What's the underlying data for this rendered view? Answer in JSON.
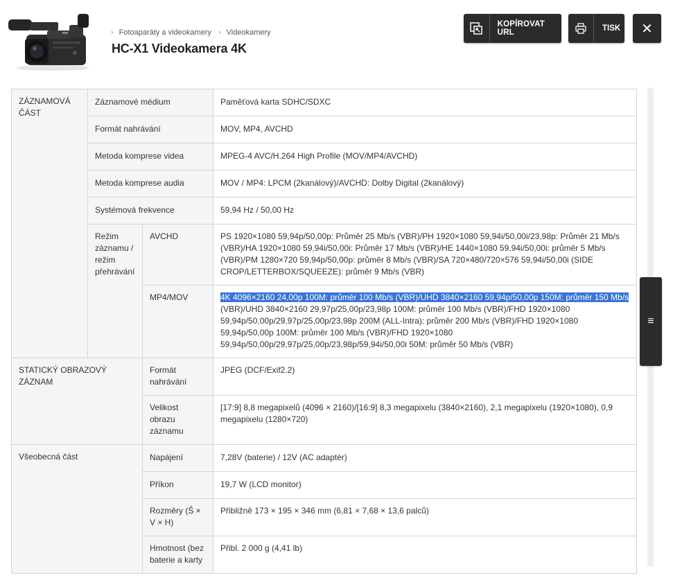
{
  "header": {
    "breadcrumb": [
      "Fotoaparáty a videokamery",
      "Videokamery"
    ],
    "title": "HC-X1 Videokamera 4K"
  },
  "actions": {
    "copy_url": "KOPÍROVAT URL",
    "print": "TISK",
    "close": "✕"
  },
  "scroll": {
    "thumb_glyph": "≡"
  },
  "specs": {
    "recording": {
      "group": "ZÁZNAMOVÁ ČÁST",
      "medium": {
        "label": "Záznamové médium",
        "value": "Paměťová karta SDHC/SDXC"
      },
      "format": {
        "label": "Formát nahrávání",
        "value": "MOV, MP4, AVCHD"
      },
      "video_compression": {
        "label": "Metoda komprese videa",
        "value": "MPEG-4 AVC/H.264 High Profile (MOV/MP4/AVCHD)"
      },
      "audio_compression": {
        "label": "Metoda komprese audia",
        "value": "MOV / MP4: LPCM (2kanálový)/AVCHD: Dolby Digital (2kanálový)"
      },
      "system_frequency": {
        "label": "Systémová frekvence",
        "value": "59,94 Hz / 50,00 Hz"
      },
      "mode": {
        "label": "Režim záznamu / režim přehrávání",
        "avchd": {
          "label": "AVCHD",
          "value": "PS 1920×1080 59,94p/50,00p: Průměr 25 Mb/s (VBR)/PH 1920×1080 59,94i/50,00i/23,98p: Průměr 21 Mb/s (VBR)/HA 1920×1080 59,94i/50,00i: Průměr 17 Mb/s (VBR)/HE 1440×1080 59,94i/50,00i: průměr 5 Mb/s (VBR)/PM 1280×720 59,94p/50,00p: průměr 8 Mb/s (VBR)/SA 720×480/720×576 59,94i/50,00i (SIDE CROP/LETTERBOX/SQUEEZE): průměr 9 Mb/s (VBR)"
        },
        "mp4mov": {
          "label": "MP4/MOV",
          "value_selected": "4K 4096×2160 24,00p 100M: průměr 100 Mb/s (VBR)/UHD 3840×2160 59,94p/50,00p 150M: průměr 150 Mb/s",
          "value_rest": " (VBR)/UHD 3840×2160 29,97p/25,00p/23,98p 100M: průměr 100 Mb/s (VBR)/FHD 1920×1080 59,94p/50,00p/29,97p/25,00p/23,98p 200M (ALL-Intra): průměr 200 Mb/s (VBR)/FHD 1920×1080 59,94p/50,00p 100M: průměr 100 Mb/s (VBR)/FHD 1920×1080 59,94p/50,00p/29,97p/25,00p/23,98p/59,94i/50,00i 50M: průměr 50 Mb/s (VBR)"
        }
      }
    },
    "still": {
      "group": "STATICKÝ OBRAZOVÝ ZÁZNAM",
      "format": {
        "label": "Formát nahrávání",
        "value": "JPEG (DCF/Exif2.2)"
      },
      "size": {
        "label": "Velikost obrazu záznamu",
        "value": "[17:9] 8,8 megapixelů (4096 × 2160)/[16:9] 8,3 megapixelu (3840×2160), 2,1 megapixelu (1920×1080), 0,9 megapixelu (1280×720)"
      }
    },
    "general": {
      "group": "Všeobecná část",
      "power": {
        "label": "Napájení",
        "value": "7,28V (baterie) / 12V (AC adaptér)"
      },
      "consumption": {
        "label": "Příkon",
        "value": "19,7 W (LCD monitor)"
      },
      "dimensions": {
        "label": "Rozměry (Š × V × H)",
        "value": "Přibližně 173 × 195 × 346 mm (6,81 × 7,68 × 13,6 palců)"
      },
      "weight": {
        "label": "Hmotnost (bez baterie a karty",
        "value": "Přibl. 2 000 g (4,41 lb)"
      }
    }
  }
}
